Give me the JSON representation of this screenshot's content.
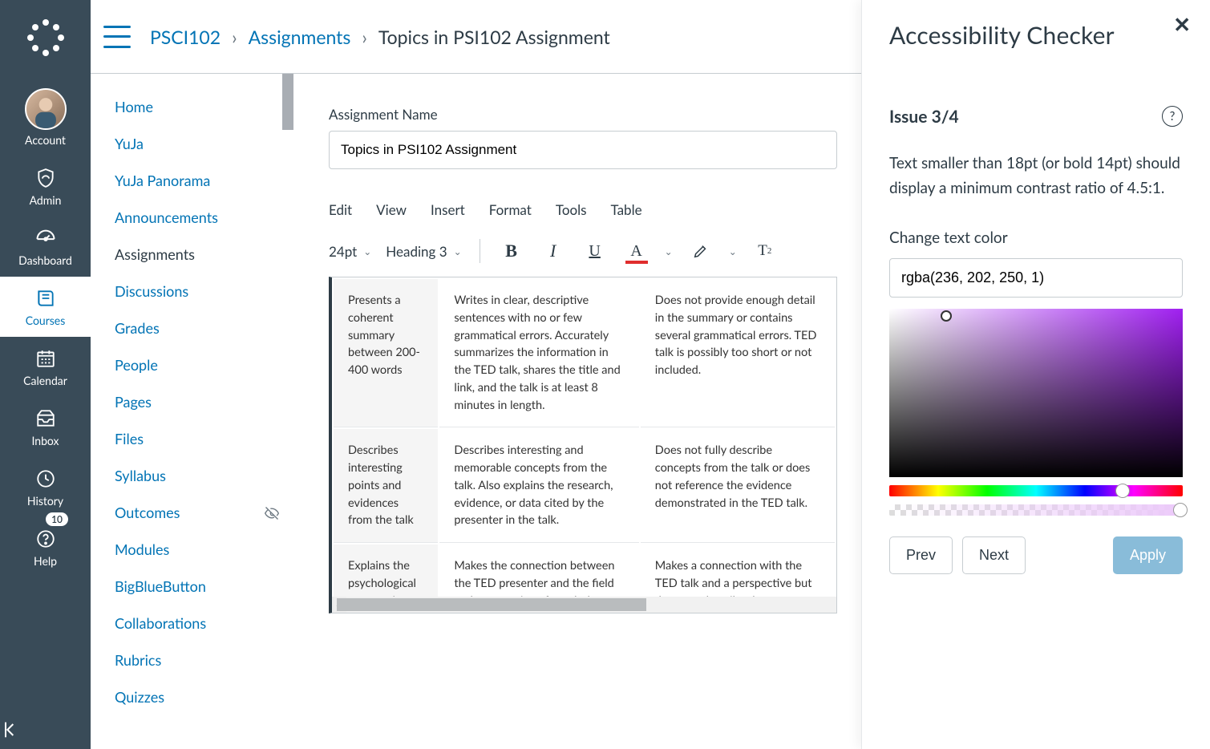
{
  "globalNav": {
    "account": "Account",
    "admin": "Admin",
    "dashboard": "Dashboard",
    "courses": "Courses",
    "calendar": "Calendar",
    "inbox": "Inbox",
    "history": "History",
    "help": "Help",
    "help_badge": "10"
  },
  "breadcrumb": {
    "course": "PSCI102",
    "section": "Assignments",
    "page": "Topics in PSI102 Assignment"
  },
  "courseNav": {
    "items": [
      {
        "label": "Home"
      },
      {
        "label": "YuJa"
      },
      {
        "label": "YuJa Panorama"
      },
      {
        "label": "Announcements"
      },
      {
        "label": "Assignments",
        "active": true
      },
      {
        "label": "Discussions"
      },
      {
        "label": "Grades"
      },
      {
        "label": "People"
      },
      {
        "label": "Pages"
      },
      {
        "label": "Files"
      },
      {
        "label": "Syllabus"
      },
      {
        "label": "Outcomes",
        "hidden": true
      },
      {
        "label": "Modules"
      },
      {
        "label": "BigBlueButton"
      },
      {
        "label": "Collaborations"
      },
      {
        "label": "Rubrics"
      },
      {
        "label": "Quizzes"
      }
    ]
  },
  "editor": {
    "field_label": "Assignment Name",
    "name_value": "Topics in PSI102 Assignment",
    "menus": {
      "edit": "Edit",
      "view": "View",
      "insert": "Insert",
      "format": "Format",
      "tools": "Tools",
      "table": "Table"
    },
    "font_size": "24pt",
    "paragraph": "Heading 3",
    "rubric": [
      {
        "c1": "Presents a coherent summary between 200-400 words",
        "c2": "Writes in clear, descriptive sentences with no or few grammatical errors. Accurately summarizes the information in the TED talk, shares the title and link, and the talk is at least 8 minutes in length.",
        "c3": "Does not provide enough detail in the summary or contains several grammatical errors. TED talk is possibly too short or not included."
      },
      {
        "c1": "Describes interesting points and evidences from the talk",
        "c2": "Describes interesting and memorable concepts from the talk. Also explains the research, evidence, or data cited by the presenter in the talk.",
        "c3": "Does not fully describe concepts from the talk or does not reference the evidence demonstrated in the TED talk."
      },
      {
        "c1": "Explains the psychological perspective fitting the presenter",
        "c2": "Makes the connection between the TED presenter and the field and perspective of psychology that he or she is presenting about. Describes this perspective",
        "c3": "Makes a connection with the TED talk and a perspective but does not describe the perspective or demonstrate an understanding of the"
      }
    ]
  },
  "a11y": {
    "title": "Accessibility Checker",
    "issue_label": "Issue 3/4",
    "description": "Text smaller than 18pt (or bold 14pt) should display a minimum contrast ratio of 4.5:1.",
    "change_label": "Change text color",
    "color_value": "rgba(236, 202, 250, 1)",
    "prev": "Prev",
    "next": "Next",
    "apply": "Apply"
  }
}
